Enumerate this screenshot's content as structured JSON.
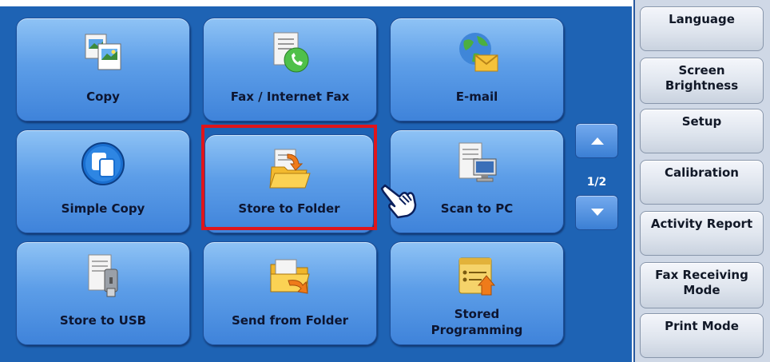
{
  "tiles": [
    {
      "label": "Copy",
      "icon": "copy-icon"
    },
    {
      "label": "Fax / Internet Fax",
      "icon": "fax-icon"
    },
    {
      "label": "E-mail",
      "icon": "email-icon"
    },
    {
      "label": "Simple Copy",
      "icon": "simple-copy-icon"
    },
    {
      "label": "Store to Folder",
      "icon": "store-folder-icon"
    },
    {
      "label": "Scan to PC",
      "icon": "scan-pc-icon"
    },
    {
      "label": "Store to USB",
      "icon": "usb-icon"
    },
    {
      "label": "Send from Folder",
      "icon": "send-folder-icon"
    },
    {
      "label": "Stored\nProgramming",
      "icon": "stored-programming-icon"
    }
  ],
  "pager": {
    "indicator": "1/2",
    "up_icon": "arrow-up-icon",
    "down_icon": "arrow-down-icon"
  },
  "side": {
    "items": [
      {
        "label": "Language"
      },
      {
        "label": "Screen\nBrightness"
      },
      {
        "label": "Setup"
      },
      {
        "label": "Calibration"
      },
      {
        "label": "Activity Report"
      },
      {
        "label": "Fax Receiving\nMode"
      },
      {
        "label": "Print Mode"
      }
    ]
  },
  "colors": {
    "panel": "#1e63b4",
    "highlight": "#e0151b",
    "side": "#cfd8e6"
  },
  "highlighted_tile": "Store to Folder"
}
